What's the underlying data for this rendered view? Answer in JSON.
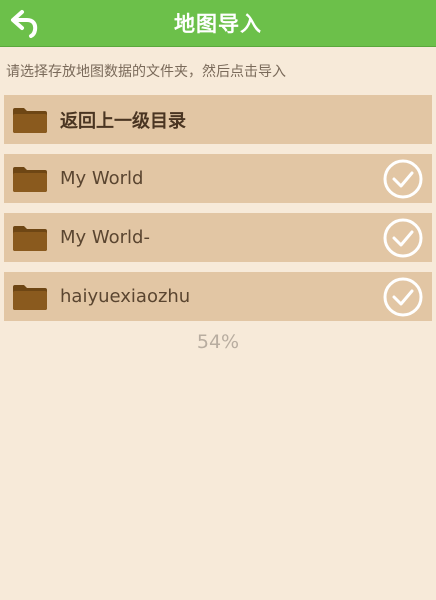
{
  "header": {
    "title": "地图导入",
    "back_icon": "back-arrow-icon"
  },
  "instruction": "请选择存放地图数据的文件夹，然后点击导入",
  "rows": [
    {
      "label": "返回上一级目录",
      "icon": "folder-icon",
      "checkable": false
    },
    {
      "label": "My World",
      "icon": "folder-icon",
      "checkable": true
    },
    {
      "label": "My World-",
      "icon": "folder-icon",
      "checkable": true
    },
    {
      "label": "haiyuexiaozhu",
      "icon": "folder-icon",
      "checkable": true
    }
  ],
  "progress_text": "54%",
  "colors": {
    "header_bg": "#6cc04a",
    "page_bg": "#f7ead9",
    "row_bg": "#e2c6a4",
    "folder": "#8a5a1e"
  }
}
